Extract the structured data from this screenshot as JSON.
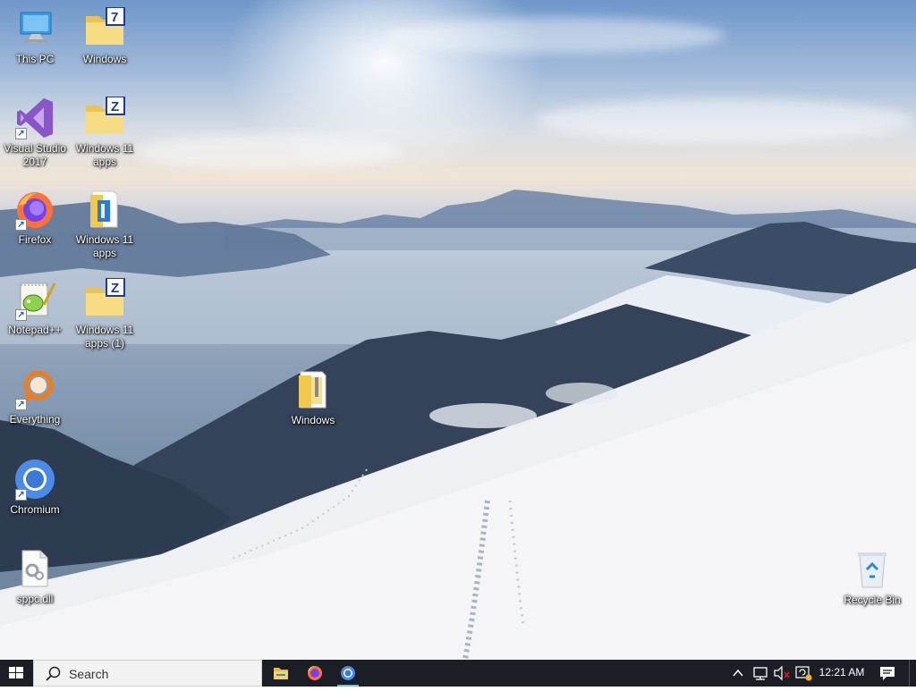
{
  "desktop": {
    "icons": [
      {
        "label": "This PC",
        "icon": "this-pc-icon",
        "shortcut": false
      },
      {
        "label": "Windows",
        "icon": "winrar-folder-icon",
        "badge": "7",
        "shortcut": false
      },
      {
        "label": "Visual Studio 2017",
        "icon": "visual-studio-icon",
        "shortcut": true
      },
      {
        "label": "Windows 11 apps",
        "icon": "winzip-folder-icon",
        "badge": "Z",
        "shortcut": false
      },
      {
        "label": "Firefox",
        "icon": "firefox-icon",
        "shortcut": true
      },
      {
        "label": "Windows 11 apps",
        "icon": "zipped-folder-icon",
        "shortcut": false
      },
      {
        "label": "Notepad++",
        "icon": "notepad-plus-plus-icon",
        "shortcut": true
      },
      {
        "label": "Windows 11 apps (1)",
        "icon": "winzip-folder-icon",
        "badge": "Z",
        "shortcut": false
      },
      {
        "label": "Everything",
        "icon": "everything-search-icon",
        "shortcut": true
      },
      {
        "label": "Windows",
        "icon": "zipped-folder-icon",
        "shortcut": false
      },
      {
        "label": "Chromium",
        "icon": "chromium-icon",
        "shortcut": true
      },
      {
        "label": "sppc.dll",
        "icon": "dll-file-icon",
        "shortcut": false
      },
      {
        "label": "Recycle Bin",
        "icon": "recycle-bin-icon",
        "shortcut": false
      }
    ]
  },
  "taskbar": {
    "search_placeholder": "Search",
    "pinned": [
      {
        "name": "File Explorer",
        "icon": "file-explorer-icon",
        "active": false
      },
      {
        "name": "Firefox",
        "icon": "firefox-icon",
        "active": false
      },
      {
        "name": "Chromium",
        "icon": "chromium-icon",
        "active": true
      }
    ],
    "tray": {
      "icons": [
        "chevron-up-icon",
        "network-icon",
        "volume-muted-icon",
        "update-icon",
        "notification-icon"
      ],
      "time": "12:21 AM"
    }
  },
  "colors": {
    "taskbar": "#1b1e25",
    "search_box": "#f2f2f2",
    "active_indicator": "#76b9ed"
  }
}
